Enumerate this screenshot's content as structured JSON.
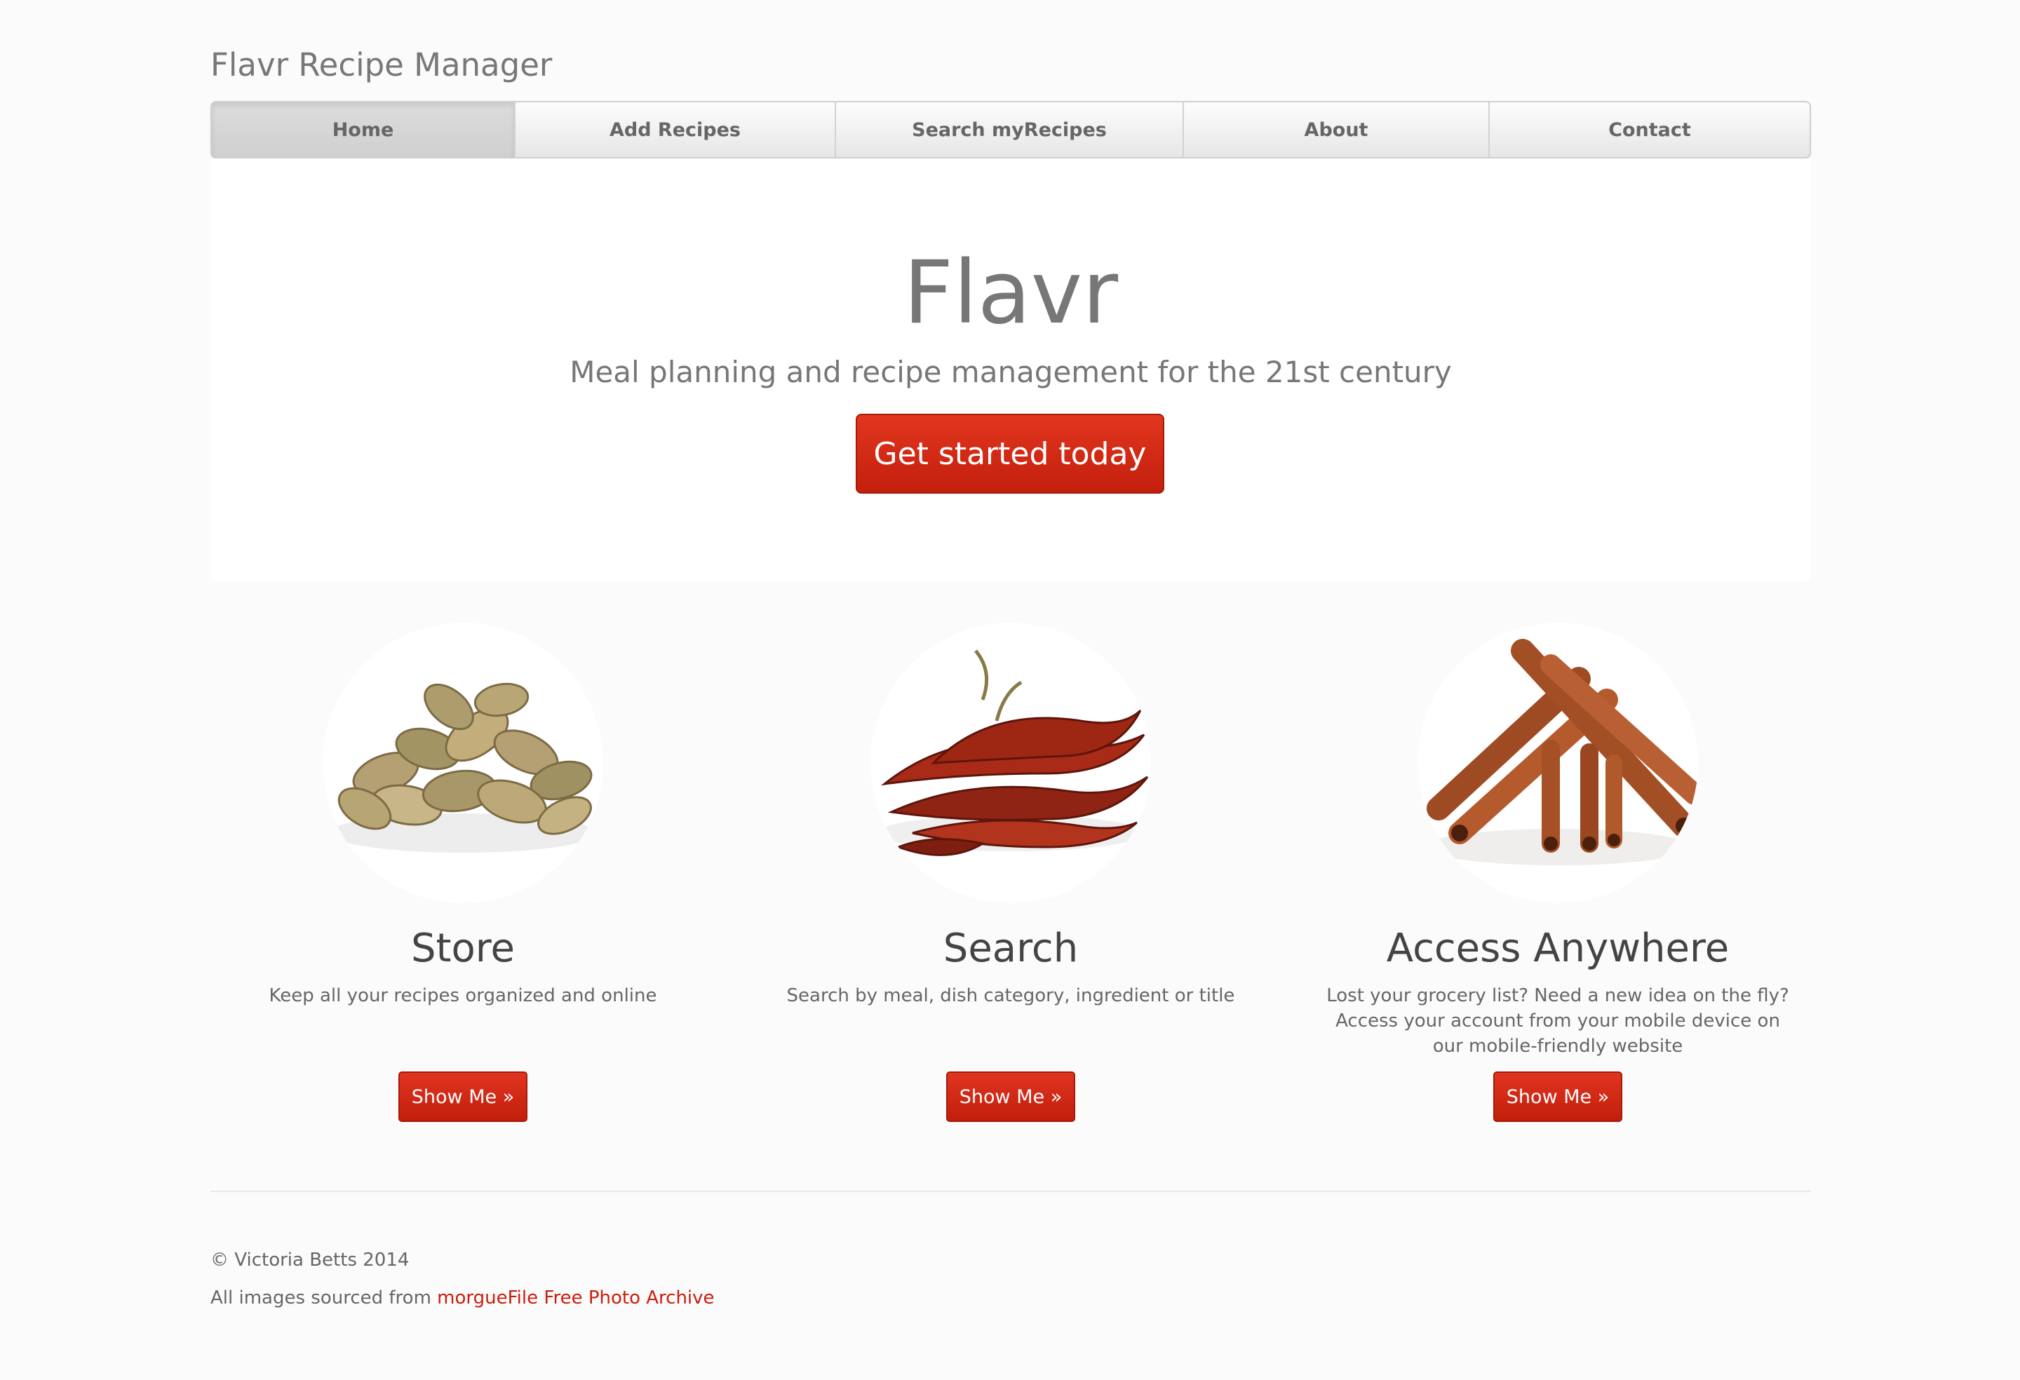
{
  "brand": "Flavr Recipe Manager",
  "nav": {
    "items": [
      {
        "label": "Home"
      },
      {
        "label": "Add Recipes"
      },
      {
        "label": "Search myRecipes"
      },
      {
        "label": "About"
      },
      {
        "label": "Contact"
      }
    ],
    "active": "Home"
  },
  "hero": {
    "title": "Flavr",
    "subtitle": "Meal planning and recipe management for the 21st century",
    "cta_label": "Get started today"
  },
  "features": [
    {
      "title": "Store",
      "description": "Keep all your recipes organized and online",
      "button_label": "Show Me »",
      "image": "cardamom-pods-image"
    },
    {
      "title": "Search",
      "description": "Search by meal, dish category, ingredient or title",
      "button_label": "Show Me »",
      "image": "dried-chili-peppers-image"
    },
    {
      "title": "Access Anywhere",
      "description": "Lost your grocery list? Need a new idea on the fly? Access your account from your mobile device on our mobile-friendly website",
      "button_label": "Show Me »",
      "image": "cinnamon-sticks-image"
    }
  ],
  "footer": {
    "copyright": "© Victoria Betts 2014",
    "credit_prefix": "All images sourced from ",
    "credit_link": "morgueFile Free Photo Archive"
  },
  "colors": {
    "accent": "#cc1d0c",
    "background": "#fbfbfb",
    "text": "#777777"
  }
}
